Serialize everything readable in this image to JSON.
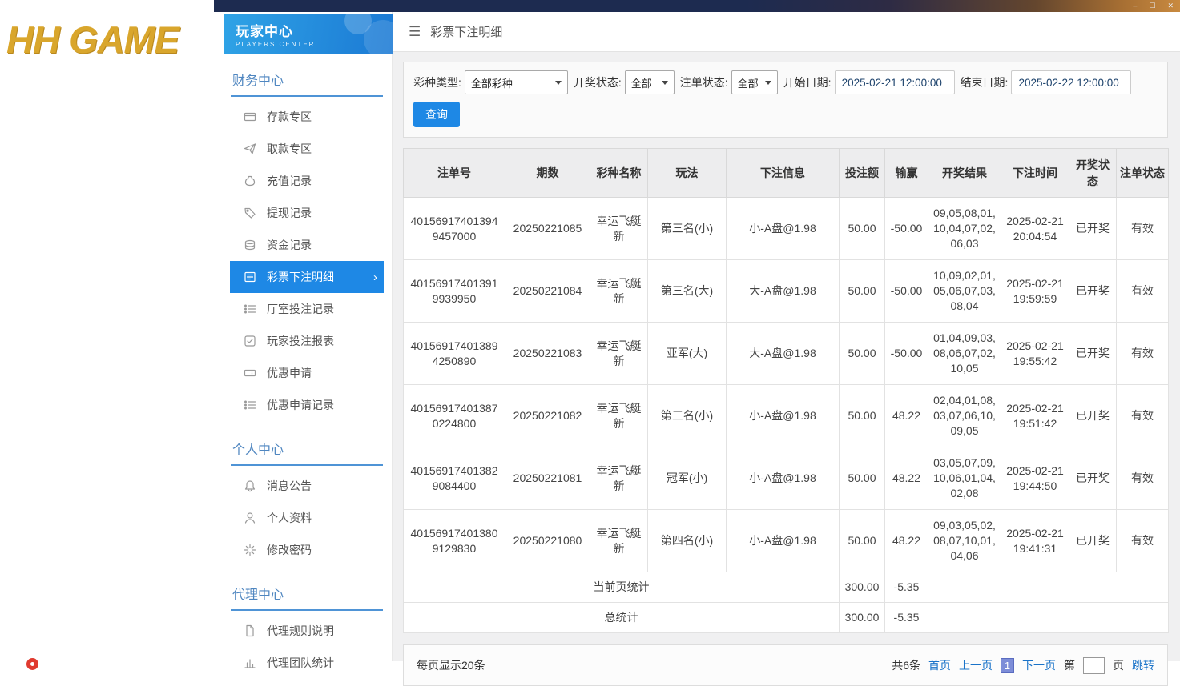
{
  "window": {
    "controls": {
      "minimize": "–",
      "maximize": "☐",
      "close": "✕"
    }
  },
  "logo": {
    "text": "HH GAME"
  },
  "sidebar": {
    "header": {
      "title": "玩家中心",
      "subtitle": "PLAYERS CENTER"
    },
    "sections": [
      {
        "title": "财务中心",
        "items": [
          {
            "label": "存款专区",
            "icon": "deposit-card-icon"
          },
          {
            "label": "取款专区",
            "icon": "withdrawal-send-icon"
          },
          {
            "label": "充值记录",
            "icon": "recharge-record-icon"
          },
          {
            "label": "提现记录",
            "icon": "withdraw-record-icon"
          },
          {
            "label": "资金记录",
            "icon": "funds-record-icon"
          },
          {
            "label": "彩票下注明细",
            "icon": "lottery-bet-detail-icon",
            "active": true
          },
          {
            "label": "厅室投注记录",
            "icon": "hall-bet-record-icon"
          },
          {
            "label": "玩家投注报表",
            "icon": "player-bet-report-icon"
          },
          {
            "label": "优惠申请",
            "icon": "promo-apply-icon"
          },
          {
            "label": "优惠申请记录",
            "icon": "promo-record-icon"
          }
        ]
      },
      {
        "title": "个人中心",
        "items": [
          {
            "label": "消息公告",
            "icon": "bell-icon"
          },
          {
            "label": "个人资料",
            "icon": "person-icon"
          },
          {
            "label": "修改密码",
            "icon": "gear-icon"
          }
        ]
      },
      {
        "title": "代理中心",
        "items": [
          {
            "label": "代理规则说明",
            "icon": "document-icon"
          },
          {
            "label": "代理团队统计",
            "icon": "bar-chart-icon"
          }
        ]
      }
    ]
  },
  "page": {
    "title": "彩票下注明细"
  },
  "filters": {
    "lottery_type": {
      "label": "彩种类型:",
      "value": "全部彩种"
    },
    "draw_status": {
      "label": "开奖状态:",
      "value": "全部"
    },
    "bet_status": {
      "label": "注单状态:",
      "value": "全部"
    },
    "start_date": {
      "label": "开始日期:",
      "value": "2025-02-21 12:00:00"
    },
    "end_date": {
      "label": "结束日期:",
      "value": "2025-02-22 12:00:00"
    },
    "search_button": "查询"
  },
  "table": {
    "headers": [
      "注单号",
      "期数",
      "彩种名称",
      "玩法",
      "下注信息",
      "投注额",
      "输赢",
      "开奖结果",
      "下注时间",
      "开奖状态",
      "注单状态"
    ],
    "rows": [
      [
        "401569174013949457000",
        "20250221085",
        "幸运飞艇新",
        "第三名(小)",
        "小-A盘@1.98",
        "50.00",
        "-50.00",
        "09,05,08,01,10,04,07,02,06,03",
        "2025-02-21 20:04:54",
        "已开奖",
        "有效"
      ],
      [
        "401569174013919939950",
        "20250221084",
        "幸运飞艇新",
        "第三名(大)",
        "大-A盘@1.98",
        "50.00",
        "-50.00",
        "10,09,02,01,05,06,07,03,08,04",
        "2025-02-21 19:59:59",
        "已开奖",
        "有效"
      ],
      [
        "401569174013894250890",
        "20250221083",
        "幸运飞艇新",
        "亚军(大)",
        "大-A盘@1.98",
        "50.00",
        "-50.00",
        "01,04,09,03,08,06,07,02,10,05",
        "2025-02-21 19:55:42",
        "已开奖",
        "有效"
      ],
      [
        "401569174013870224800",
        "20250221082",
        "幸运飞艇新",
        "第三名(小)",
        "小-A盘@1.98",
        "50.00",
        "48.22",
        "02,04,01,08,03,07,06,10,09,05",
        "2025-02-21 19:51:42",
        "已开奖",
        "有效"
      ],
      [
        "401569174013829084400",
        "20250221081",
        "幸运飞艇新",
        "冠军(小)",
        "小-A盘@1.98",
        "50.00",
        "48.22",
        "03,05,07,09,10,06,01,04,02,08",
        "2025-02-21 19:44:50",
        "已开奖",
        "有效"
      ],
      [
        "401569174013809129830",
        "20250221080",
        "幸运飞艇新",
        "第四名(小)",
        "小-A盘@1.98",
        "50.00",
        "48.22",
        "09,03,05,02,08,07,10,01,04,06",
        "2025-02-21 19:41:31",
        "已开奖",
        "有效"
      ]
    ],
    "summary": [
      {
        "label": "当前页统计",
        "bet_total": "300.00",
        "win_loss_total": "-5.35"
      },
      {
        "label": "总统计",
        "bet_total": "300.00",
        "win_loss_total": "-5.35"
      }
    ]
  },
  "pagination": {
    "page_size_text": "每页显示20条",
    "total_text": "共6条",
    "first": "首页",
    "prev": "上一页",
    "current_page": "1",
    "next": "下一页",
    "jump_prefix": "第",
    "jump_suffix": "页",
    "jump_button": "跳转"
  },
  "colors": {
    "accent_blue": "#1e88e5",
    "sidebar_header_gradient": [
      "#2fa3e6",
      "#1b79d4"
    ],
    "link_blue": "#1a73c9",
    "logo_gold": "#d9a62c",
    "topbar_navy": "#1d2b50",
    "topbar_orange": "#c98a40",
    "current_page_box": "#7d8dd8"
  }
}
